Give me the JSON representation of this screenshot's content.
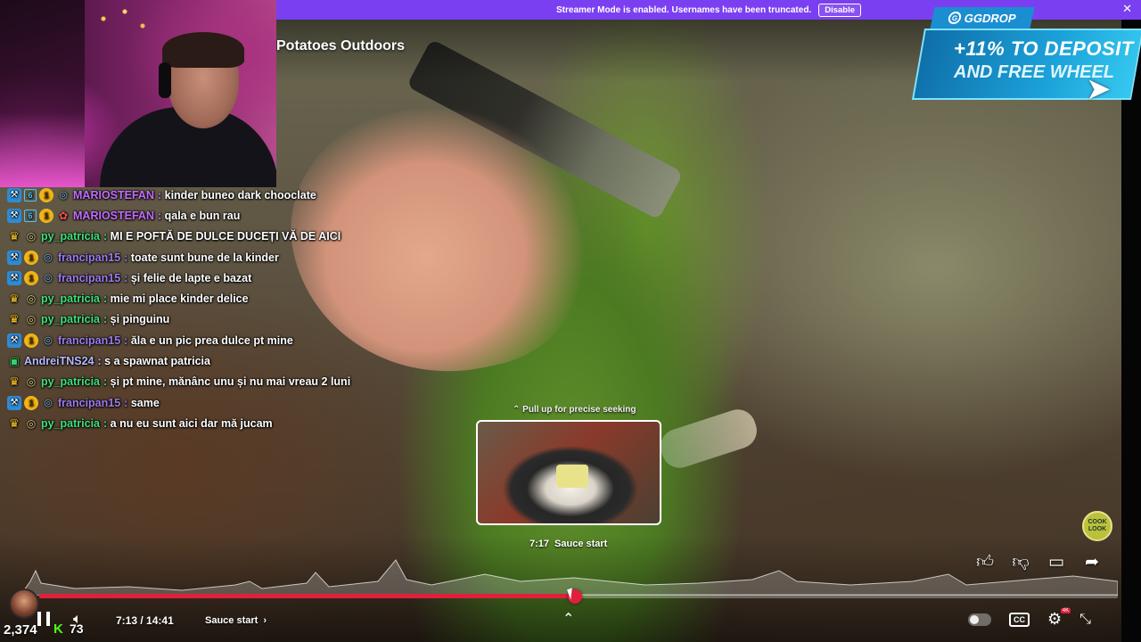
{
  "banner": {
    "text": "Streamer Mode is enabled. Usernames have been truncated.",
    "button_label": "Disable",
    "close_glyph": "✕",
    "color": "#7b3ff2"
  },
  "video": {
    "title": "Potatoes Outdoors",
    "logo_text": "COOK LOOK"
  },
  "ad": {
    "brand": "GGDROP",
    "line1": "+11% TO DEPOSIT",
    "line2": "AND FREE WHEEL"
  },
  "chat": [
    {
      "badges": [
        "mod",
        "sub",
        "coin",
        "cam"
      ],
      "name": "MARIOSTEFAN",
      "color": "#c56bff",
      "message": "kinder buneo dark chooclate"
    },
    {
      "badges": [
        "mod",
        "sub",
        "coin",
        "gift"
      ],
      "name": "MARIOSTEFAN",
      "color": "#c56bff",
      "message": "qala e bun rau"
    },
    {
      "badges": [
        "crown",
        "ring"
      ],
      "name": "py_patricia",
      "color": "#3ee07a",
      "message": "MI E POFTĂ DE DULCE DUCEȚI VĂ DE AICI"
    },
    {
      "badges": [
        "mod",
        "coin",
        "cam"
      ],
      "name": "francipan15",
      "color": "#9b7cf0",
      "message": "toate sunt bune de la kinder"
    },
    {
      "badges": [
        "mod",
        "coin",
        "cam"
      ],
      "name": "francipan15",
      "color": "#9b7cf0",
      "message": "și felie de lapte e bazat"
    },
    {
      "badges": [
        "crown",
        "ring"
      ],
      "name": "py_patricia",
      "color": "#3ee07a",
      "message": "mie mi place kinder delice"
    },
    {
      "badges": [
        "crown",
        "ring"
      ],
      "name": "py_patricia",
      "color": "#3ee07a",
      "message": "și pinguinu"
    },
    {
      "badges": [
        "mod",
        "coin",
        "cam"
      ],
      "name": "francipan15",
      "color": "#9b7cf0",
      "message": "ăla e un pic prea dulce pt mine"
    },
    {
      "badges": [
        "green"
      ],
      "name": "AndreiTNS24",
      "color": "#b9b9ff",
      "message": "s a spawnat patricia"
    },
    {
      "badges": [
        "crown",
        "ring"
      ],
      "name": "py_patricia",
      "color": "#3ee07a",
      "message": "și pt mine, mănânc unu și nu mai vreau 2 luni"
    },
    {
      "badges": [
        "mod",
        "coin",
        "cam"
      ],
      "name": "francipan15",
      "color": "#9b7cf0",
      "message": "same"
    },
    {
      "badges": [
        "crown",
        "ring"
      ],
      "name": "py_patricia",
      "color": "#3ee07a",
      "message": "a nu eu sunt aici dar mă jucam"
    }
  ],
  "seek": {
    "hint": "Pull up for precise seeking",
    "preview_time": "7:17",
    "preview_chapter": "Sauce start",
    "progress_fraction": 0.497
  },
  "player": {
    "current_time": "7:13",
    "duration": "14:41",
    "chapter": "Sauce start",
    "chapter_chevron": "›",
    "accent_color": "#e0203b",
    "cc_label": "CC",
    "quality_badge": "4K"
  },
  "stream": {
    "viewers": "2,374",
    "kick_glyph": "K",
    "kick_count": "73",
    "kick_color": "#53fc18"
  },
  "icons": {
    "like": "like-icon",
    "dislike": "dislike-icon",
    "comments": "comments-icon",
    "share": "share-icon"
  }
}
